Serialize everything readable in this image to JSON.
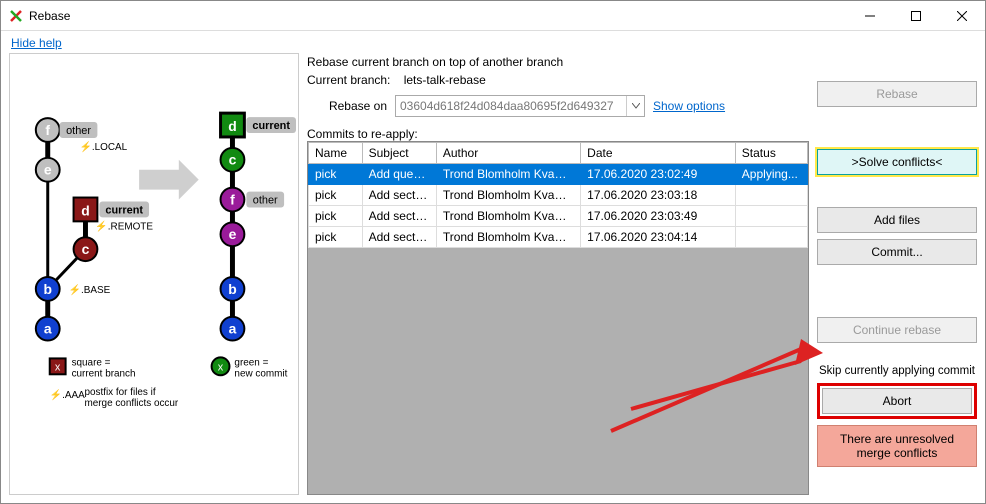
{
  "window": {
    "title": "Rebase"
  },
  "help_link": "Hide help",
  "header": {
    "line1": "Rebase current branch on top of another branch",
    "branch_label": "Current branch:",
    "branch_value": "lets-talk-rebase",
    "rebase_on_label": "Rebase on",
    "rebase_on_value": "03604d618f24d084daa80695f2d649327",
    "show_options": "Show options"
  },
  "commits_label": "Commits to re-apply:",
  "columns": {
    "name": "Name",
    "subject": "Subject",
    "author": "Author",
    "date": "Date",
    "status": "Status"
  },
  "rows": [
    {
      "name": "pick",
      "subject": "Add quest...",
      "author": "Trond Blomholm Kvamme...",
      "date": "17.06.2020 23:02:49",
      "status": "Applying...",
      "selected": true
    },
    {
      "name": "pick",
      "subject": "Add sectio...",
      "author": "Trond Blomholm Kvamme...",
      "date": "17.06.2020 23:03:18",
      "status": ""
    },
    {
      "name": "pick",
      "subject": "Add sectio...",
      "author": "Trond Blomholm Kvamme...",
      "date": "17.06.2020 23:03:49",
      "status": ""
    },
    {
      "name": "pick",
      "subject": "Add sectio...",
      "author": "Trond Blomholm Kvamme...",
      "date": "17.06.2020 23:04:14",
      "status": ""
    }
  ],
  "buttons": {
    "rebase": "Rebase",
    "solve": ">Solve conflicts<",
    "add_files": "Add files",
    "commit": "Commit...",
    "continue": "Continue rebase",
    "skip": "Skip currently applying commit",
    "abort": "Abort"
  },
  "error": "There are unresolved merge conflicts",
  "diagram": {
    "left_top_label": "other",
    "left_top_sub": "⚡.LOCAL",
    "left_mid_label": "current",
    "left_mid_sub": "⚡.REMOTE",
    "left_base": "⚡.BASE",
    "right_top_label": "current",
    "right_other": "other",
    "legend_square1": "square =",
    "legend_square2": "current branch",
    "legend_green1": "green =",
    "legend_green2": "new commit",
    "legend_aaa_tag": "⚡.AAA",
    "legend_aaa1": "postfix for files if",
    "legend_aaa2": "merge conflicts occur"
  }
}
